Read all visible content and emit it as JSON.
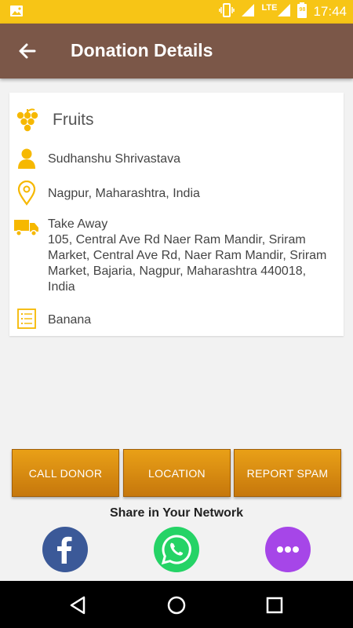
{
  "status_bar": {
    "network": "LTE",
    "time": "17:44",
    "battery_level": "98"
  },
  "app_bar": {
    "title": "Donation Details"
  },
  "donation": {
    "category": "Fruits",
    "donor_name": "Sudhanshu Shrivastava",
    "location": "Nagpur, Maharashtra, India",
    "delivery_type": "Take Away",
    "address": "105, Central Ave Rd Naer Ram Mandir, Sriram Market, Central Ave Rd, Naer Ram Mandir, Sriram Market, Bajaria, Nagpur, Maharashtra 440018, India",
    "items": "Banana"
  },
  "actions": {
    "call_donor": "CALL DONOR",
    "location": "LOCATION",
    "report_spam": "REPORT SPAM"
  },
  "share": {
    "title": "Share in Your Network"
  },
  "icons": [
    "image-icon",
    "vibrate-icon",
    "signal-icon",
    "battery-icon",
    "back-arrow-icon",
    "grapes-icon",
    "person-icon",
    "location-pin-icon",
    "truck-icon",
    "list-icon",
    "facebook-icon",
    "whatsapp-icon",
    "more-icon",
    "nav-back-icon",
    "nav-home-icon",
    "nav-recents-icon"
  ],
  "colors": {
    "status_bar": "#f7c516",
    "app_bar": "#7b5748",
    "icon_accent": "#f6b800",
    "button": "#d9880f",
    "facebook": "#3b5998",
    "whatsapp": "#25d366",
    "more": "#a646e8"
  }
}
